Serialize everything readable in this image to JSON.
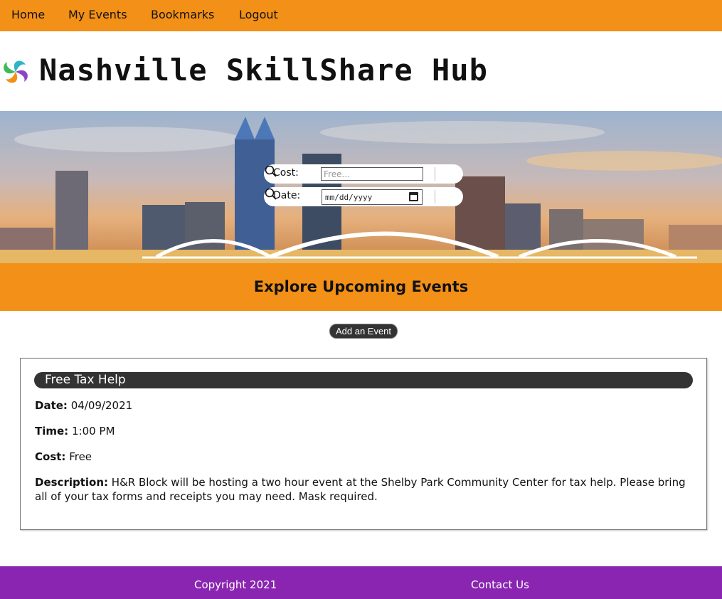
{
  "nav": {
    "items": [
      {
        "label": "Home"
      },
      {
        "label": "My Events"
      },
      {
        "label": "Bookmarks"
      },
      {
        "label": "Logout"
      }
    ]
  },
  "brand": {
    "title": "Nashville SkillShare Hub",
    "logo_icon": "colorful-swirl-logo-icon"
  },
  "filters": {
    "cost": {
      "label": "Cost:",
      "placeholder": "Free..."
    },
    "date": {
      "label": "Date:",
      "placeholder": "mm/dd/yyyy"
    },
    "search_icon": "search-icon"
  },
  "section": {
    "title": "Explore Upcoming Events",
    "add_button": "Add an Event"
  },
  "events": [
    {
      "title": "Free Tax Help",
      "date_label": "Date:",
      "date": "04/09/2021",
      "time_label": "Time:",
      "time": "1:00 PM",
      "cost_label": "Cost:",
      "cost": "Free",
      "description_label": "Description:",
      "description": "H&R Block will be hosting a two hour event at the Shelby Park Community Center for tax help. Please bring all of your tax forms and receipts you may need. Mask required."
    }
  ],
  "footer": {
    "copyright": "Copyright 2021",
    "contact": "Contact Us"
  },
  "colors": {
    "nav_bg": "#f39017",
    "footer_bg": "#8a25b1",
    "card_header_bg": "#333333"
  }
}
